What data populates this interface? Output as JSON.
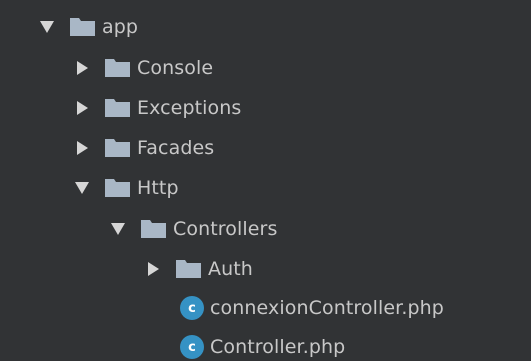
{
  "tree": {
    "items": [
      {
        "label": "app",
        "kind": "folder",
        "expanded": true,
        "depth": 0,
        "icon": "folder-icon"
      },
      {
        "label": "Console",
        "kind": "folder",
        "expanded": false,
        "depth": 1,
        "icon": "folder-icon"
      },
      {
        "label": "Exceptions",
        "kind": "folder",
        "expanded": false,
        "depth": 1,
        "icon": "folder-icon"
      },
      {
        "label": "Facades",
        "kind": "folder",
        "expanded": false,
        "depth": 1,
        "icon": "folder-icon"
      },
      {
        "label": "Http",
        "kind": "folder",
        "expanded": true,
        "depth": 1,
        "icon": "folder-icon"
      },
      {
        "label": "Controllers",
        "kind": "folder",
        "expanded": true,
        "depth": 2,
        "icon": "folder-icon"
      },
      {
        "label": "Auth",
        "kind": "folder",
        "expanded": false,
        "depth": 3,
        "icon": "folder-icon"
      },
      {
        "label": "connexionController.php",
        "kind": "php-class-file",
        "depth": 3,
        "icon": "php-class-icon",
        "icon_letter": "c"
      },
      {
        "label": "Controller.php",
        "kind": "php-class-file",
        "depth": 3,
        "icon": "php-class-icon",
        "icon_letter": "c"
      }
    ]
  },
  "colors": {
    "background": "#313335",
    "text": "#c8c8c8",
    "folder": "#a9b7c6",
    "php_class_icon": "#3592c4"
  }
}
